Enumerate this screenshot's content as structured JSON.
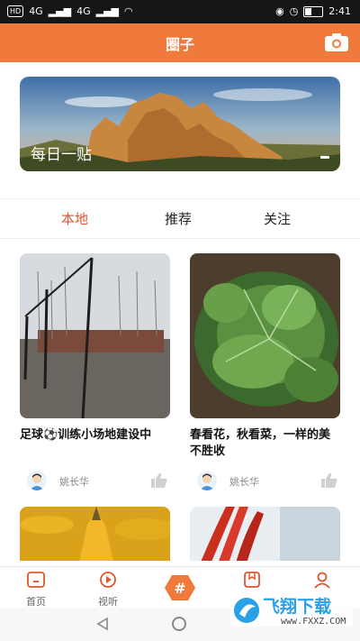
{
  "status_bar": {
    "left_badge": "HD",
    "net1": "4G",
    "net2": "4G",
    "time": "2:41"
  },
  "app_bar": {
    "title": "圈子",
    "camera_icon": "camera-icon"
  },
  "banner": {
    "caption": "每日一贴"
  },
  "tabs": [
    {
      "label": "本地",
      "active": true
    },
    {
      "label": "推荐",
      "active": false
    },
    {
      "label": "关注",
      "active": false
    }
  ],
  "posts": [
    {
      "title": "足球⚽训练小场地建设中",
      "author": "姚长华"
    },
    {
      "title": "春看花，秋看菜，一样的美不胜收",
      "author": "姚长华"
    }
  ],
  "bottom_nav": [
    {
      "label": "首页",
      "icon": "home-icon"
    },
    {
      "label": "视听",
      "icon": "play-icon"
    },
    {
      "label": "",
      "icon": "hash-icon"
    },
    {
      "label": "",
      "icon": "bookmark-icon"
    },
    {
      "label": "",
      "icon": "profile-icon"
    }
  ],
  "watermark": {
    "text": "飞翔下载",
    "sub": "www.FXXZ.COM"
  },
  "colors": {
    "accent": "#f07a3c",
    "active_tab": "#e0552d"
  }
}
